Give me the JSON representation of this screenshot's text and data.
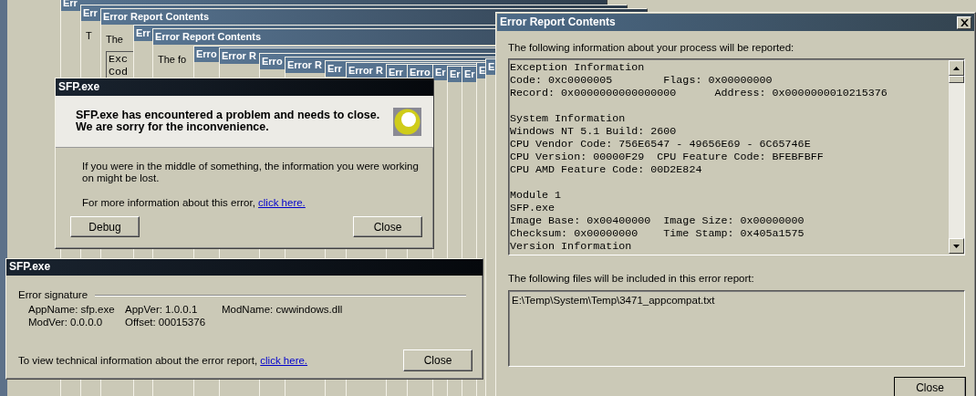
{
  "background_windows": [
    {
      "title": "Err"
    },
    {
      "title": "Err",
      "body": [
        "T"
      ]
    },
    {
      "title": "Error Report Contents",
      "body": [
        "The"
      ],
      "box_lines": [
        "Exc",
        "Cod"
      ]
    },
    {
      "title": "Err"
    },
    {
      "title": "Error Report Contents",
      "body": [
        "The fo"
      ]
    },
    {
      "title": "Erro"
    },
    {
      "title": "Error R"
    },
    {
      "title": "Erro"
    },
    {
      "title": "Error R"
    },
    {
      "title": "Err"
    },
    {
      "title": "Error R"
    },
    {
      "title": "Err"
    },
    {
      "title": "Erro"
    },
    {
      "title": "Er"
    },
    {
      "title": "Er"
    },
    {
      "title": "Er"
    },
    {
      "title": "E"
    },
    {
      "title": "E"
    }
  ],
  "error_dialog": {
    "title": "SFP.exe",
    "heading": [
      "SFP.exe has encountered a problem and needs to close.",
      "We are sorry for the inconvenience."
    ],
    "message": "If you were in the middle of something, the information you were working on might be lost.",
    "more_info": "For more information about this error,",
    "link": "click here.",
    "buttons": [
      "Debug",
      "Close"
    ]
  },
  "signature_dialog": {
    "title": "SFP.exe",
    "group_label": "Error signature",
    "rows": [
      [
        "AppName: sfp.exe",
        "AppVer: 1.0.0.1",
        "ModName: cwwindows.dll"
      ],
      [
        "ModVer: 0.0.0.0",
        "Offset: 00015376"
      ]
    ],
    "footer": "To view technical information about the error report,",
    "link": "click here.",
    "button": "Close"
  },
  "report_window": {
    "title": "Error Report Contents",
    "intro": "The following information about your process will be reported:",
    "sections": [
      [
        "Exception Information",
        "Code: 0xc0000005        Flags: 0x00000000",
        "Record: 0x0000000000000000      Address: 0x0000000010215376"
      ],
      [
        "System Information",
        "Windows NT 5.1 Build: 2600",
        "CPU Vendor Code: 756E6547 - 49656E69 - 6C65746E",
        "CPU Version: 00000F29  CPU Feature Code: BFEBFBFF",
        "CPU AMD Feature Code: 00D2E824"
      ],
      [
        "Module 1",
        "SFP.exe",
        "Image Base: 0x00400000  Image Size: 0x00000000",
        "Checksum: 0x00000000    Time Stamp: 0x405a1575",
        "Version Information"
      ]
    ],
    "files_label": "The following files will be included in this error report:",
    "files": [
      "E:\\Temp\\System\\Temp\\3471_appcompat.txt"
    ],
    "button": "Close"
  }
}
